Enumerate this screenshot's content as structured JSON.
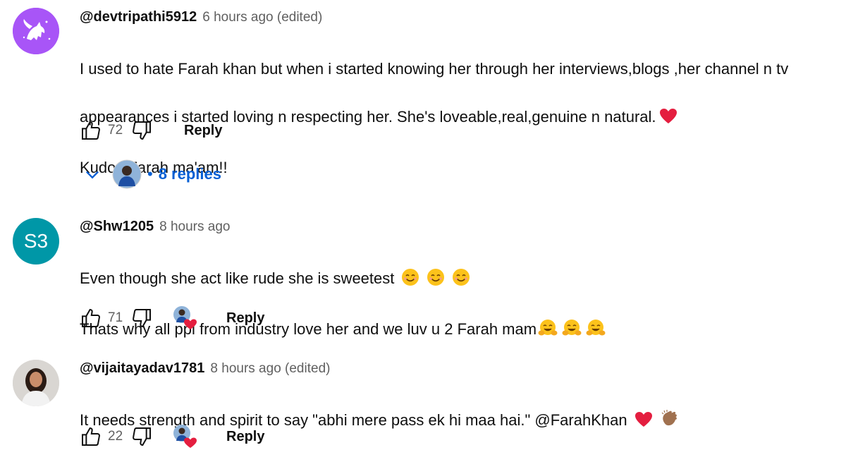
{
  "comments": [
    {
      "author": "@devtripathi5912",
      "time": "6 hours ago (edited)",
      "lines": [
        "I used to hate Farah khan but when i started knowing her through her interviews,blogs ,her channel n tv",
        "appearances i started loving n respecting her. She's loveable,real,genuine n natural.",
        "Kudos Farah ma'am!!"
      ],
      "likes": "72",
      "reply_label": "Reply",
      "replies_label": "8 replies",
      "avatar_color": "#a855f7"
    },
    {
      "author": "@Shw1205",
      "time": "8 hours ago",
      "avatar_initials": "S3",
      "avatar_color": "#0097a7",
      "lines": [
        "Even though she act like rude she is sweetest",
        "Thats why all ppl from industry love her and we luv u 2 Farah mam"
      ],
      "likes": "71",
      "reply_label": "Reply"
    },
    {
      "author": "@vijaitayadav1781",
      "time": "8 hours ago (edited)",
      "lines": [
        "It needs strength and spirit to say \"abhi mere pass ek hi maa hai.\" @FarahKhan"
      ],
      "likes": "22",
      "reply_label": "Reply"
    }
  ],
  "colors": {
    "link": "#065fd4",
    "meta": "#606060",
    "heart": "#e41e3f"
  },
  "icons": [
    "thumb-up-icon",
    "thumb-down-icon",
    "chevron-down-icon",
    "creator-heart-icon",
    "heart-emoji",
    "smile-emoji",
    "hug-emoji",
    "clap-emoji"
  ]
}
